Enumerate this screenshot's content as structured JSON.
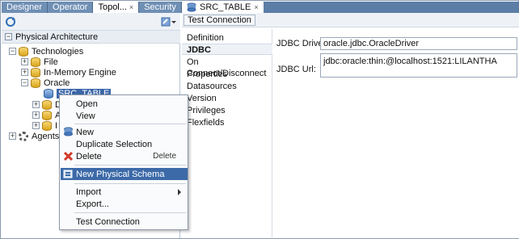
{
  "left_panel": {
    "tabs": [
      "Designer",
      "Operator",
      "Topol...",
      "Security"
    ],
    "close_glyph": "×",
    "section_title": "Physical Architecture",
    "tree": {
      "technologies": "Technologies",
      "file": "File",
      "in_memory": "In-Memory Engine",
      "oracle": "Oracle",
      "src_table": "SRC_TABLE",
      "agents": "Agents",
      "child_initials": [
        "D",
        "A",
        "I"
      ]
    }
  },
  "right_panel": {
    "tab_title": "SRC_TABLE",
    "close_glyph": "×",
    "test_connection": "Test Connection",
    "nav": [
      "Definition",
      "JDBC",
      "On Connect/Disconnect",
      "Properties",
      "Datasources",
      "Version",
      "Privileges",
      "Flexfields"
    ],
    "active_nav": "JDBC",
    "jdbc_driver_label": "JDBC Driver:",
    "jdbc_driver_value": "oracle.jdbc.OracleDriver",
    "jdbc_url_label": "JDBC Url:",
    "jdbc_url_value": "jdbc:oracle:thin:@localhost:1521:LILANTHA"
  },
  "context_menu": {
    "items": [
      {
        "label": "Open"
      },
      {
        "label": "View"
      },
      {
        "label": "New"
      },
      {
        "label": "Duplicate Selection"
      },
      {
        "label": "Delete",
        "accelerator": "Delete"
      },
      {
        "label": "New Physical Schema",
        "highlighted": true
      },
      {
        "label": "Import",
        "submenu": true
      },
      {
        "label": "Export..."
      },
      {
        "label": "Test Connection"
      }
    ]
  },
  "colors": {
    "tab_bar": "#5c7ea6",
    "selection": "#3c6aa8",
    "delete_icon": "#d03a2a"
  },
  "icons": [
    "refresh-icon",
    "new-item-icon",
    "folder-db-icon",
    "data-server-icon",
    "gear-icon",
    "delete-x-icon",
    "new-schema-icon"
  ]
}
